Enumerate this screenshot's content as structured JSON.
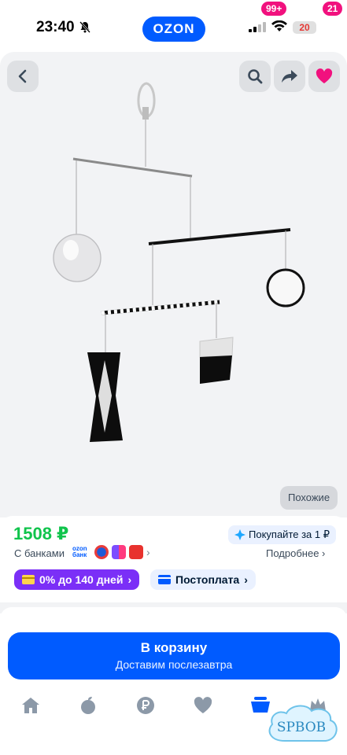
{
  "status_bar": {
    "time": "23:40",
    "brand": "OZON",
    "battery": "20"
  },
  "product": {
    "similar_label": "Похожие",
    "price": "1508 ₽",
    "promo": "Покупайте за 1 ₽",
    "banks_label": "С банками",
    "bank_ozon": "ozon банк",
    "more_label": "Подробнее",
    "credit_label": "0% до 140 дней",
    "postpay_label": "Постоплата"
  },
  "cart_button": {
    "title": "В корзину",
    "subtitle": "Доставим послезавтра"
  },
  "tabbar": {
    "cart_badge": "99+",
    "profile_badge": "21"
  },
  "watermark": "SPBOB",
  "colors": {
    "brand": "#005bff",
    "price": "#10c44c",
    "badge": "#f1117e",
    "credit": "#7b2ff7"
  },
  "icons": [
    "bell-off-icon",
    "signal-icon",
    "wifi-icon",
    "back-icon",
    "search-icon",
    "share-icon",
    "heart-icon",
    "sparkle-icon",
    "card-icon",
    "chevron-right-icon",
    "home-icon",
    "fresh-icon",
    "ruble-icon",
    "favorites-icon",
    "cart-icon",
    "profile-icon"
  ]
}
